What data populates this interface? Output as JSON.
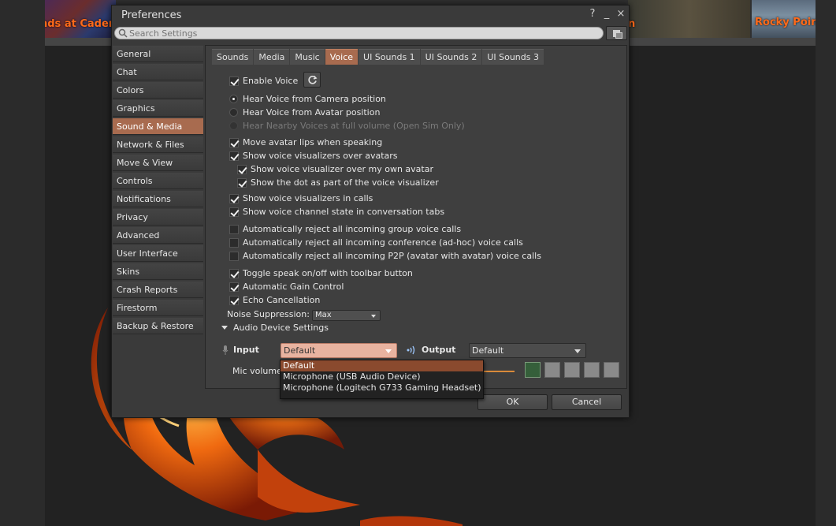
{
  "background": {
    "left_thumb_label": "nds at Cadenc",
    "mid_thumb_label": "n",
    "right_thumb_label": "Rocky Point"
  },
  "window": {
    "title": "Preferences",
    "help_glyph": "?",
    "minimize_glyph": "_",
    "close_glyph": "×"
  },
  "search": {
    "placeholder": "Search Settings",
    "value": ""
  },
  "sidebar": {
    "items": [
      {
        "label": "General"
      },
      {
        "label": "Chat"
      },
      {
        "label": "Colors"
      },
      {
        "label": "Graphics"
      },
      {
        "label": "Sound & Media",
        "active": true
      },
      {
        "label": "Network & Files"
      },
      {
        "label": "Move & View"
      },
      {
        "label": "Controls"
      },
      {
        "label": "Notifications"
      },
      {
        "label": "Privacy"
      },
      {
        "label": "Advanced"
      },
      {
        "label": "User Interface"
      },
      {
        "label": "Skins"
      },
      {
        "label": "Crash Reports"
      },
      {
        "label": "Firestorm"
      },
      {
        "label": "Backup & Restore"
      }
    ]
  },
  "tabs": [
    {
      "label": "Sounds"
    },
    {
      "label": "Media"
    },
    {
      "label": "Music"
    },
    {
      "label": "Voice",
      "active": true
    },
    {
      "label": "UI Sounds 1"
    },
    {
      "label": "UI Sounds 2"
    },
    {
      "label": "UI Sounds 3"
    }
  ],
  "voice": {
    "enable_voice": {
      "label": "Enable Voice",
      "checked": true
    },
    "hear_camera": {
      "label": "Hear Voice from Camera position",
      "selected": true
    },
    "hear_avatar": {
      "label": "Hear Voice from Avatar position",
      "selected": false
    },
    "hear_nearby": {
      "label": "Hear Nearby Voices at full volume (Open Sim Only)",
      "disabled": true
    },
    "lipsync": {
      "label": "Move avatar lips when speaking",
      "checked": true
    },
    "visualizers_over_avatars": {
      "label": "Show voice visualizers over avatars",
      "checked": true
    },
    "visualizer_own": {
      "label": "Show voice visualizer over my own avatar",
      "checked": true
    },
    "visualizer_dot": {
      "label": "Show the dot as part of the voice visualizer",
      "checked": true
    },
    "visualizers_calls": {
      "label": "Show voice visualizers in calls",
      "checked": true
    },
    "channel_state": {
      "label": "Show voice channel state in conversation tabs",
      "checked": true
    },
    "reject_group": {
      "label": "Automatically reject all incoming group voice calls",
      "checked": false
    },
    "reject_conference": {
      "label": "Automatically reject all incoming conference (ad-hoc) voice calls",
      "checked": false
    },
    "reject_p2p": {
      "label": "Automatically reject all incoming P2P (avatar with avatar) voice calls",
      "checked": false
    },
    "toggle_speak": {
      "label": "Toggle speak on/off with toolbar button",
      "checked": true
    },
    "agc": {
      "label": "Automatic Gain Control",
      "checked": true
    },
    "echo": {
      "label": "Echo Cancellation",
      "checked": true
    },
    "noise_label": "Noise Suppression:",
    "noise_value": "Max",
    "audio_device_header": "Audio Device Settings",
    "input_label": "Input",
    "input_value": "Default",
    "output_label": "Output",
    "output_value": "Default",
    "mic_volume_label": "Mic volume",
    "input_options": [
      {
        "label": "Default",
        "selected": true
      },
      {
        "label": "Microphone (USB Audio Device)"
      },
      {
        "label": "Microphone (Logitech G733 Gaming Headset)"
      }
    ],
    "level_meter": {
      "active_bars": 1,
      "total_bars": 5
    }
  },
  "buttons": {
    "ok": "OK",
    "cancel": "Cancel"
  },
  "colors": {
    "accent": "#a86b4f",
    "selected_option": "#8a4a2e",
    "input_combo": "#e8b3a0"
  },
  "icons": [
    "search-icon",
    "copy-icon",
    "refresh-icon",
    "microphone-icon",
    "speaker-icon",
    "chevron-down-icon"
  ]
}
